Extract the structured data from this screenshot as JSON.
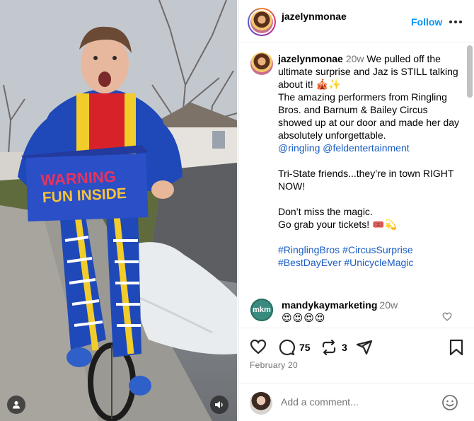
{
  "post": {
    "username": "jazelynmonae",
    "follow_label": "Follow",
    "caption": {
      "time": "20w",
      "lines": [
        "We pulled off the ultimate surprise and Jaz is STILL talking about it! 🎪✨",
        "The amazing performers from Ringling Bros. and Barnum & Bailey Circus showed up at our door and made her day absolutely unforgettable."
      ],
      "mentions": "@ringling @feldentertainment",
      "para2": "Tri-State friends...they’re in town RIGHT NOW!",
      "para3a": "Don’t miss the magic.",
      "para3b": "Go grab your tickets! 🎟️💫",
      "hashtags_1": "#RinglingBros #CircusSurprise",
      "hashtags_2": "#BestDayEver #UnicycleMagic"
    },
    "comment": {
      "username": "mandykaymarketing",
      "time": "20w",
      "text": "😍😍😍😍",
      "avatar_text": "mkm"
    },
    "actions": {
      "comments_count": "75",
      "shares_count": "3"
    },
    "date": "February 20",
    "add_comment_placeholder": "Add a comment..."
  },
  "media": {
    "box_text_1": "WARNING",
    "box_text_2": "FUN INSIDE"
  },
  "colors": {
    "accent": "#0095f6",
    "link": "#1a5dc4",
    "muted": "#737373"
  }
}
